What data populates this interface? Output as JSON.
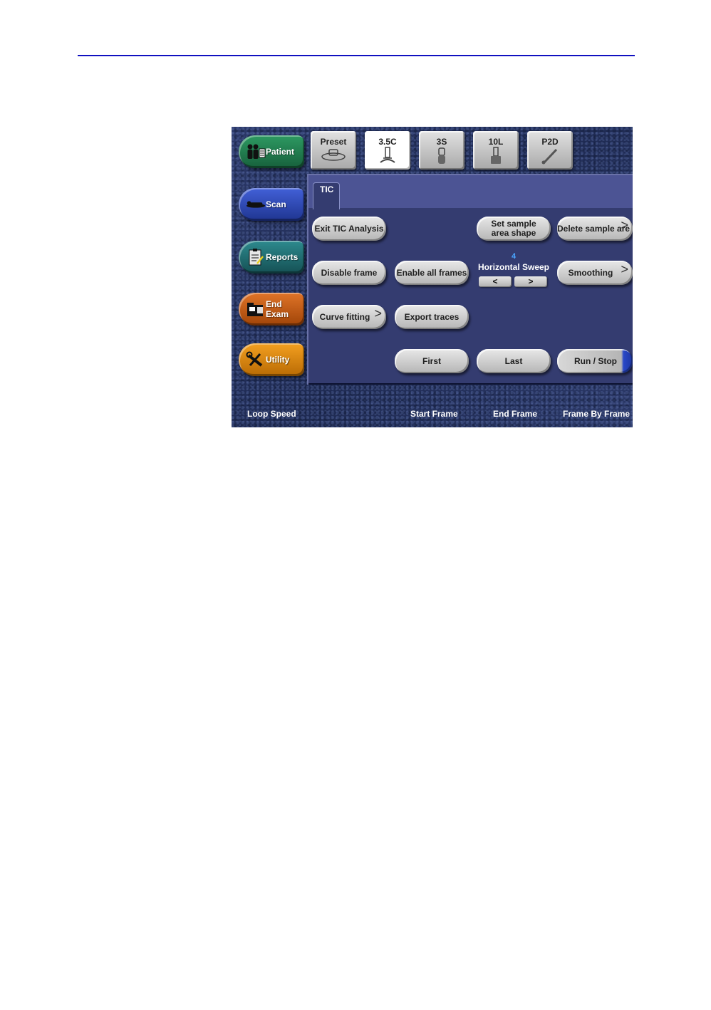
{
  "nav": {
    "patient": "Patient",
    "scan": "Scan",
    "reports": "Reports",
    "end_exam": "End\nExam",
    "utility": "Utility"
  },
  "probes": {
    "preset": "Preset",
    "p35c": "3.5C",
    "p3s": "3S",
    "p10l": "10L",
    "p2d": "P2D"
  },
  "tab_label": "TIC",
  "buttons": {
    "exit_tic": "Exit TIC Analysis",
    "set_sample_area_shape": "Set sample area shape",
    "delete_sample_area": "Delete sample are",
    "disable_frame": "Disable frame",
    "enable_all_frames": "Enable all frames",
    "smoothing": "Smoothing",
    "curve_fitting": "Curve fitting",
    "export_traces": "Export traces",
    "first": "First",
    "last": "Last",
    "run_stop": "Run / Stop"
  },
  "horizontal_sweep": {
    "value": "4",
    "label": "Horizontal Sweep",
    "left": "<",
    "right": ">"
  },
  "footer": {
    "loop_speed": "Loop Speed",
    "start_frame": "Start Frame",
    "end_frame": "End Frame",
    "frame_by_frame": "Frame By Frame"
  },
  "colors": {
    "patient": "#1e7a4e",
    "scan": "#2c45b4",
    "reports": "#1f6a6e",
    "end_exam": "#c45e14",
    "utility": "#d88410"
  },
  "icons": {
    "patient": "people-icon",
    "scan": "patient-bed-icon",
    "reports": "clipboard-icon",
    "end_exam": "folder-icon",
    "utility": "tools-icon"
  }
}
